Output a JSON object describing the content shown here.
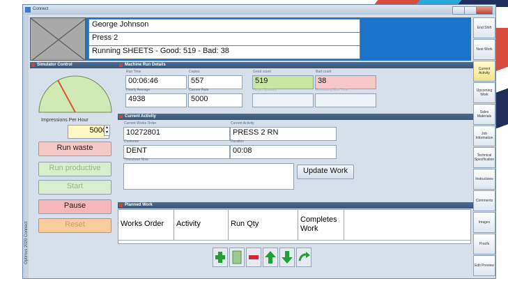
{
  "window": {
    "title": "Connect",
    "side_label": "Optimus 2020 Connect"
  },
  "header": {
    "operator": "George Johnson",
    "machine": "Press 2",
    "status": "Running SHEETS - Good: 519 - Bad: 38"
  },
  "simulator": {
    "section_title": "Simulator Control",
    "impressions_label": "Impressions Per Hour",
    "impressions_value": "5000",
    "buttons": [
      "Run waste",
      "Run productive",
      "Start",
      "Pause",
      "Reset"
    ]
  },
  "machine_run": {
    "section_title": "Machine Run Details",
    "run_time": {
      "label": "Run Time",
      "value": "00:06:46"
    },
    "copies": {
      "label": "Copies",
      "value": "557"
    },
    "good_count": {
      "label": "Good count",
      "value": "519"
    },
    "bad_count": {
      "label": "Bad count",
      "value": "38"
    },
    "hourly_average": {
      "label": "Hourly Average",
      "value": "4938"
    },
    "current_rate": {
      "label": "Current Rate",
      "value": "5000"
    },
    "target_quantity": {
      "label": "Target Quantity",
      "value": ""
    },
    "remaining_run_time": {
      "label": "Remaining Run Time",
      "value": ""
    }
  },
  "current_activity": {
    "section_title": "Current Activity",
    "works_order": {
      "label": "Current Works Order",
      "value": "10272801"
    },
    "activity": {
      "label": "Current Activity",
      "value": "PRESS 2 RN"
    },
    "customer": {
      "label": "Customer",
      "value": "DENT"
    },
    "duration": {
      "label": "Duration",
      "value": "00:08"
    },
    "timesheet_note": {
      "label": "Timesheet Note",
      "value": ""
    },
    "update_button": "Update Work"
  },
  "planned_work": {
    "section_title": "Planned Work",
    "columns": [
      "Works Order",
      "Activity",
      "Run Qty",
      "Completes Work"
    ]
  },
  "toolbar": {
    "icons": [
      "add-icon",
      "document-icon",
      "remove-icon",
      "move-up-icon",
      "move-down-icon",
      "refresh-icon"
    ]
  },
  "right_nav": [
    "End Shift",
    "Next Work",
    "Current Activity",
    "Upcoming Work",
    "Sales Materials",
    "Job Information",
    "Technical Specification",
    "Instructions",
    "Comments",
    "Images",
    "Proofs",
    "Edit Preview"
  ]
}
